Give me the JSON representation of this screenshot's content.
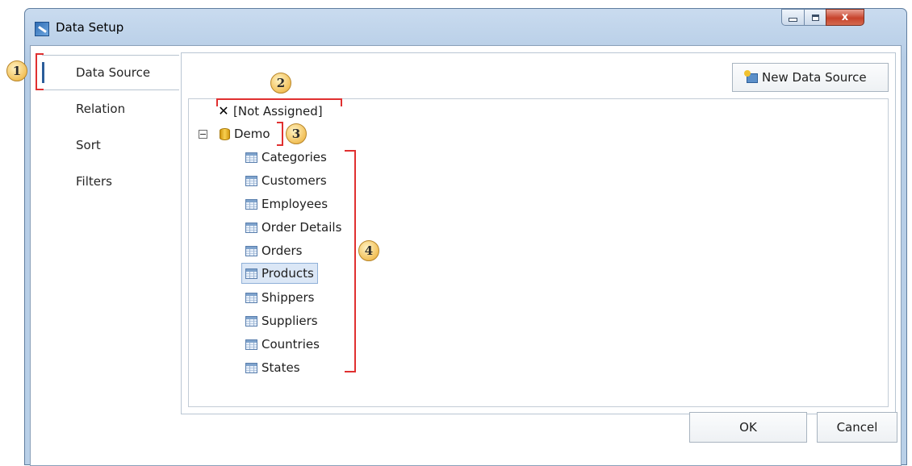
{
  "window": {
    "title": "Data Setup",
    "close_label": "x"
  },
  "nav": {
    "items": [
      "Data Source",
      "Relation",
      "Sort",
      "Filters"
    ]
  },
  "toolbar": {
    "new_data_source": "New Data Source"
  },
  "tree": {
    "not_assigned": "[Not Assigned]",
    "root": "Demo",
    "tables": [
      "Categories",
      "Customers",
      "Employees",
      "Order Details",
      "Orders",
      "Products",
      "Shippers",
      "Suppliers",
      "Countries",
      "States"
    ],
    "selected_table": "Products"
  },
  "buttons": {
    "ok": "OK",
    "cancel": "Cancel"
  },
  "annotations": [
    "1",
    "2",
    "3",
    "4"
  ],
  "colors": {
    "annotation_line": "#e03030",
    "callout_fill": "#f2c15a"
  }
}
